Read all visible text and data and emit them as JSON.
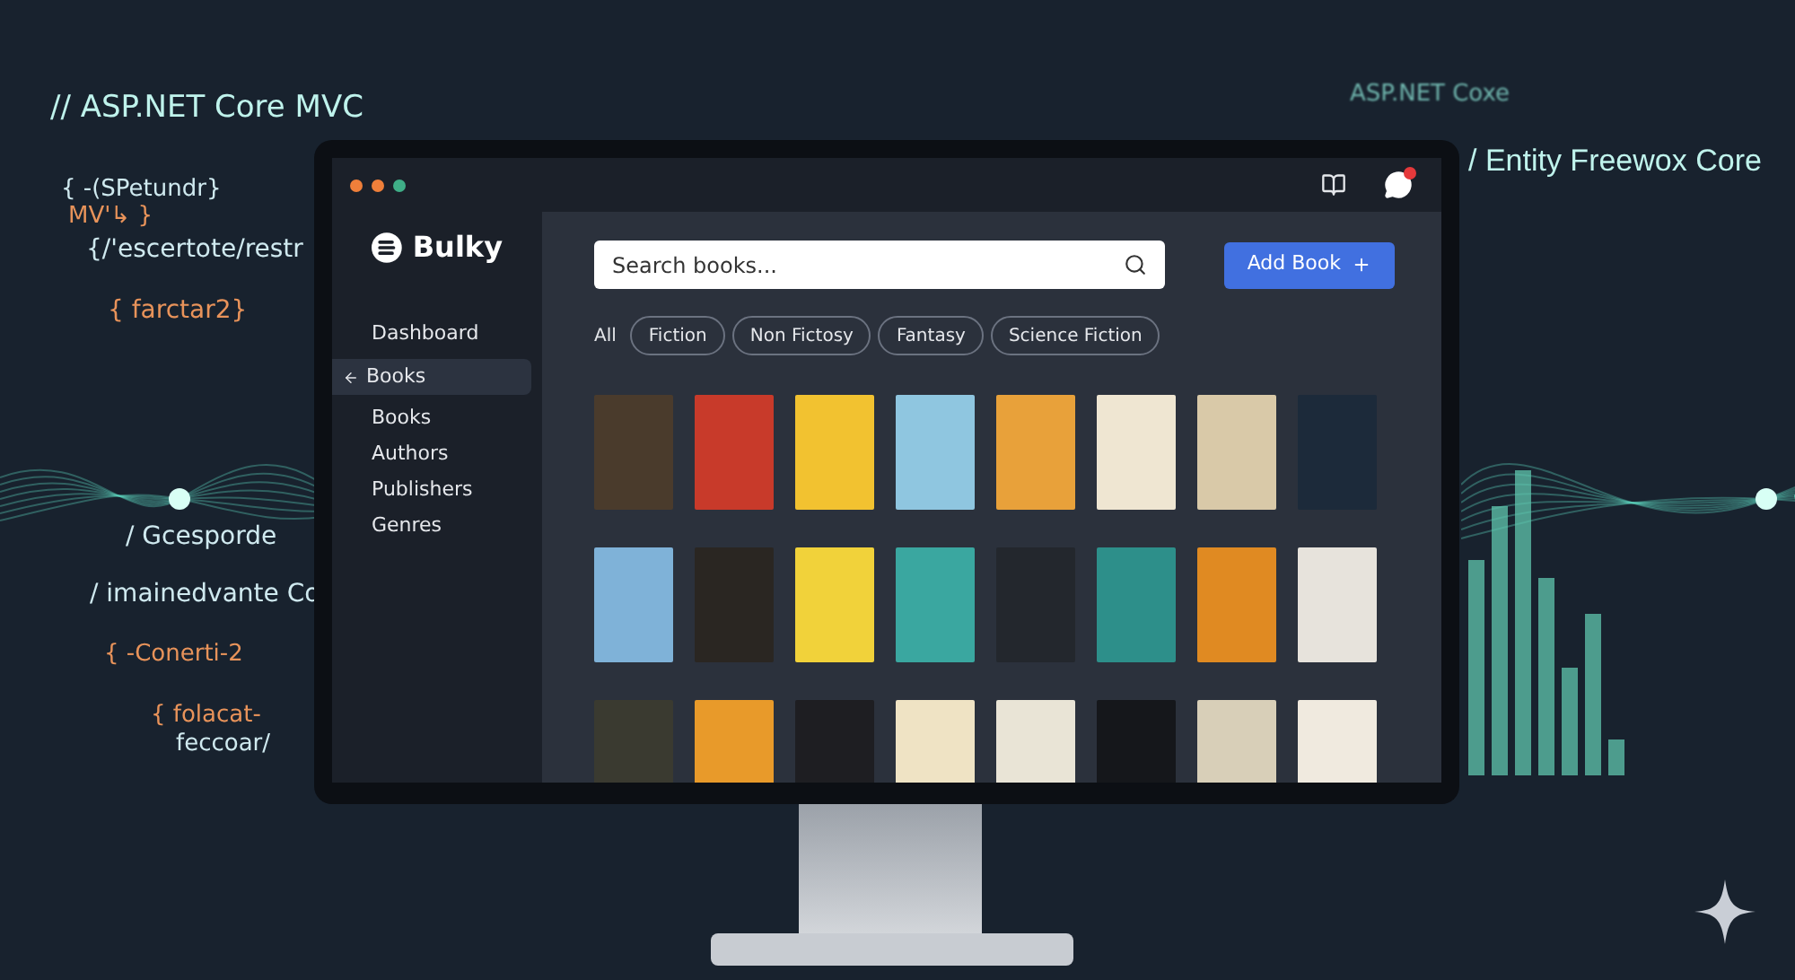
{
  "background_code": [
    {
      "text": "// ASP.NET Core MVC",
      "kind": "title"
    },
    {
      "text": "{ -(SPetundr}",
      "kind": "plain"
    },
    {
      "text": "MV'↳ }",
      "kind": "accent"
    },
    {
      "text": "{/'escertote/restr",
      "kind": "plain"
    },
    {
      "text": "{ farctar2}",
      "kind": "accent"
    },
    {
      "text": "/ Gcesporde",
      "kind": "plain"
    },
    {
      "text": "/ imainedvante Co",
      "kind": "plain"
    },
    {
      "text": "{ -Conerti-2",
      "kind": "accent"
    },
    {
      "text": "{ folacat-",
      "kind": "accent"
    },
    {
      "text": "feccoar/",
      "kind": "plain"
    }
  ],
  "background_right": [
    {
      "text": "ASP.NET Coxe",
      "kind": "faint"
    },
    {
      "text": "/ Entity Freewox Core",
      "kind": "title"
    }
  ],
  "app": {
    "brand": "Bulky",
    "nav": [
      {
        "label": "Dashboard",
        "selected": false
      },
      {
        "label": "Books",
        "selected": true
      },
      {
        "label": "Books",
        "selected": false
      },
      {
        "label": "Authors",
        "selected": false
      },
      {
        "label": "Publishers",
        "selected": false
      },
      {
        "label": "Genres",
        "selected": false
      }
    ],
    "search": {
      "placeholder": "Search books..."
    },
    "add_button": "Add Book",
    "filters": [
      {
        "label": "All",
        "selected": true
      },
      {
        "label": "Fiction",
        "selected": false
      },
      {
        "label": "Non Fictosy",
        "selected": false
      },
      {
        "label": "Fantasy",
        "selected": false
      },
      {
        "label": "Science Fiction",
        "selected": false
      }
    ]
  }
}
